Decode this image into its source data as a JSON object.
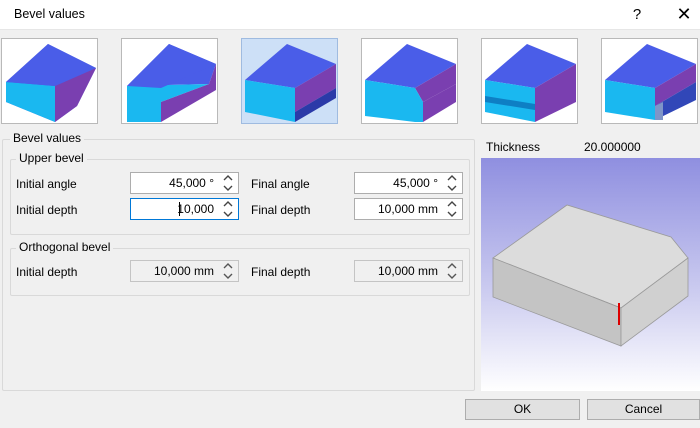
{
  "window": {
    "title": "Bevel values",
    "help_glyph": "?",
    "close_glyph": "✕"
  },
  "bevel_types": [
    {
      "icon": "bevel-type-1-icon",
      "selected": false
    },
    {
      "icon": "bevel-type-2-icon",
      "selected": false
    },
    {
      "icon": "bevel-type-3-icon",
      "selected": true
    },
    {
      "icon": "bevel-type-4-icon",
      "selected": false
    },
    {
      "icon": "bevel-type-5-icon",
      "selected": false
    },
    {
      "icon": "bevel-type-6-icon",
      "selected": false
    }
  ],
  "bevel_values": {
    "group_label": "Bevel values",
    "upper_bevel": {
      "label": "Upper bevel",
      "initial_angle_label": "Initial angle",
      "initial_angle_value": "45,000 °",
      "final_angle_label": "Final angle",
      "final_angle_value": "45,000 °",
      "initial_depth_label": "Initial depth",
      "initial_depth_value": "10,000",
      "final_depth_label": "Final depth",
      "final_depth_value": "10,000 mm"
    },
    "orthogonal_bevel": {
      "label": "Orthogonal bevel",
      "initial_depth_label": "Initial depth",
      "initial_depth_value": "10,000 mm",
      "final_depth_label": "Final depth",
      "final_depth_value": "10,000 mm"
    }
  },
  "thickness": {
    "label": "Thickness",
    "value": "20.000000"
  },
  "buttons": {
    "ok": "OK",
    "cancel": "Cancel"
  },
  "colors": {
    "bevel_blue": "#4a5de8",
    "bevel_purple": "#7a3fb0",
    "bevel_cyan": "#1ab8f0",
    "preview_bg_top": "#8f8fe0",
    "preview_bg_bottom": "#ffffff",
    "selected_tile": "#cde0f7",
    "marker_red": "#dd0000"
  }
}
